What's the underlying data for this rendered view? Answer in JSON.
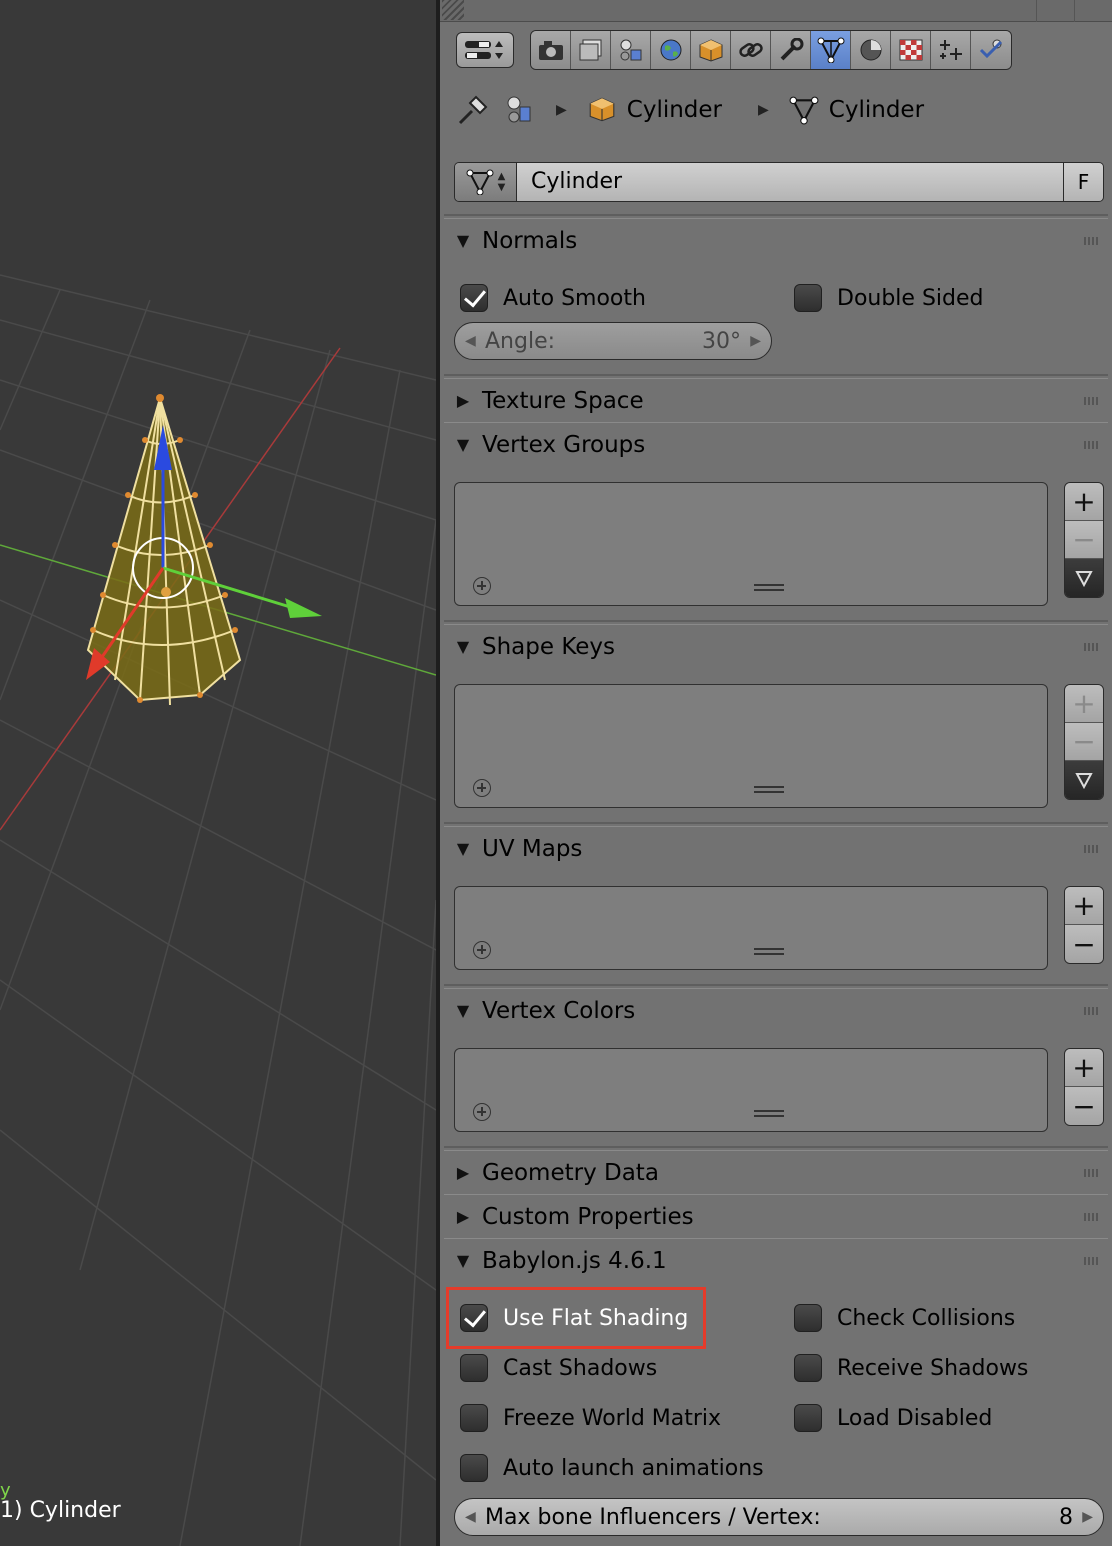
{
  "viewport": {
    "object_label": "1) Cylinder",
    "axis_label": "y"
  },
  "breadcrumb": {
    "object_name": "Cylinder",
    "mesh_name": "Cylinder"
  },
  "datablock": {
    "name": "Cylinder",
    "fake_user": "F"
  },
  "normals": {
    "title": "Normals",
    "auto_smooth": {
      "label": "Auto Smooth",
      "checked": true
    },
    "double_sided": {
      "label": "Double Sided",
      "checked": false
    },
    "angle": {
      "label": "Angle:",
      "value": "30°"
    }
  },
  "sections": {
    "texture_space": "Texture Space",
    "vertex_groups": "Vertex Groups",
    "shape_keys": "Shape Keys",
    "uv_maps": "UV Maps",
    "vertex_colors": "Vertex Colors",
    "geometry_data": "Geometry Data",
    "custom_properties": "Custom Properties",
    "babylon": "Babylon.js 4.6.1"
  },
  "babylon": {
    "use_flat_shading": {
      "label": "Use Flat Shading",
      "checked": true
    },
    "check_collisions": {
      "label": "Check Collisions",
      "checked": false
    },
    "cast_shadows": {
      "label": "Cast Shadows",
      "checked": false
    },
    "receive_shadows": {
      "label": "Receive Shadows",
      "checked": false
    },
    "freeze_world_matrix": {
      "label": "Freeze World Matrix",
      "checked": false
    },
    "load_disabled": {
      "label": "Load Disabled",
      "checked": false
    },
    "auto_launch_animations": {
      "label": "Auto launch animations",
      "checked": false
    },
    "max_bone": {
      "label": "Max bone Influencers / Vertex:",
      "value": "8"
    }
  },
  "icons": {
    "editor_type": "properties-editor-icon",
    "tabs": [
      "render-icon",
      "render-layers-icon",
      "scene-icon",
      "world-icon",
      "object-icon",
      "constraints-icon",
      "modifiers-icon",
      "mesh-data-icon",
      "material-icon",
      "texture-icon",
      "particles-icon",
      "physics-icon"
    ]
  },
  "colors": {
    "highlight": "#e53b2a",
    "active_tab": "#5a80c8",
    "mesh_fill": "#8a7a1c",
    "wire": "#f0e0a0"
  }
}
